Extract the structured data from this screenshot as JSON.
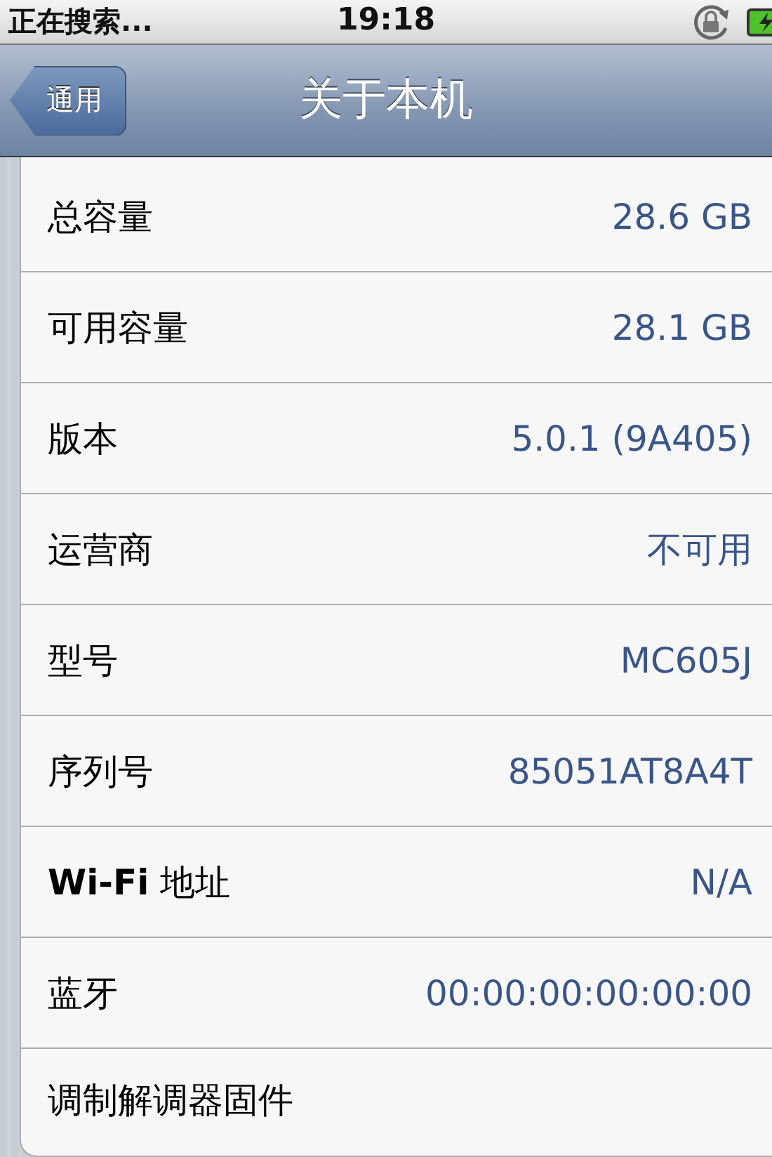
{
  "status_bar": {
    "carrier": "正在搜索...",
    "time": "19:18"
  },
  "nav_bar": {
    "back": "通用",
    "title": "关于本机"
  },
  "rows": [
    {
      "label": "总容量",
      "value": "28.6 GB"
    },
    {
      "label": "可用容量",
      "value": "28.1 GB"
    },
    {
      "label": "版本",
      "value": "5.0.1 (9A405)"
    },
    {
      "label": "运营商",
      "value": "不可用"
    },
    {
      "label": "型号",
      "value": "MC605J"
    },
    {
      "label": "序列号",
      "value": "85051AT8A4T"
    },
    {
      "label": "**Wi-Fi** 地址",
      "value": "N/A"
    },
    {
      "label": "蓝牙",
      "value": "00:00:00:00:00:00"
    },
    {
      "label": "调制解调器固件"
    }
  ]
}
